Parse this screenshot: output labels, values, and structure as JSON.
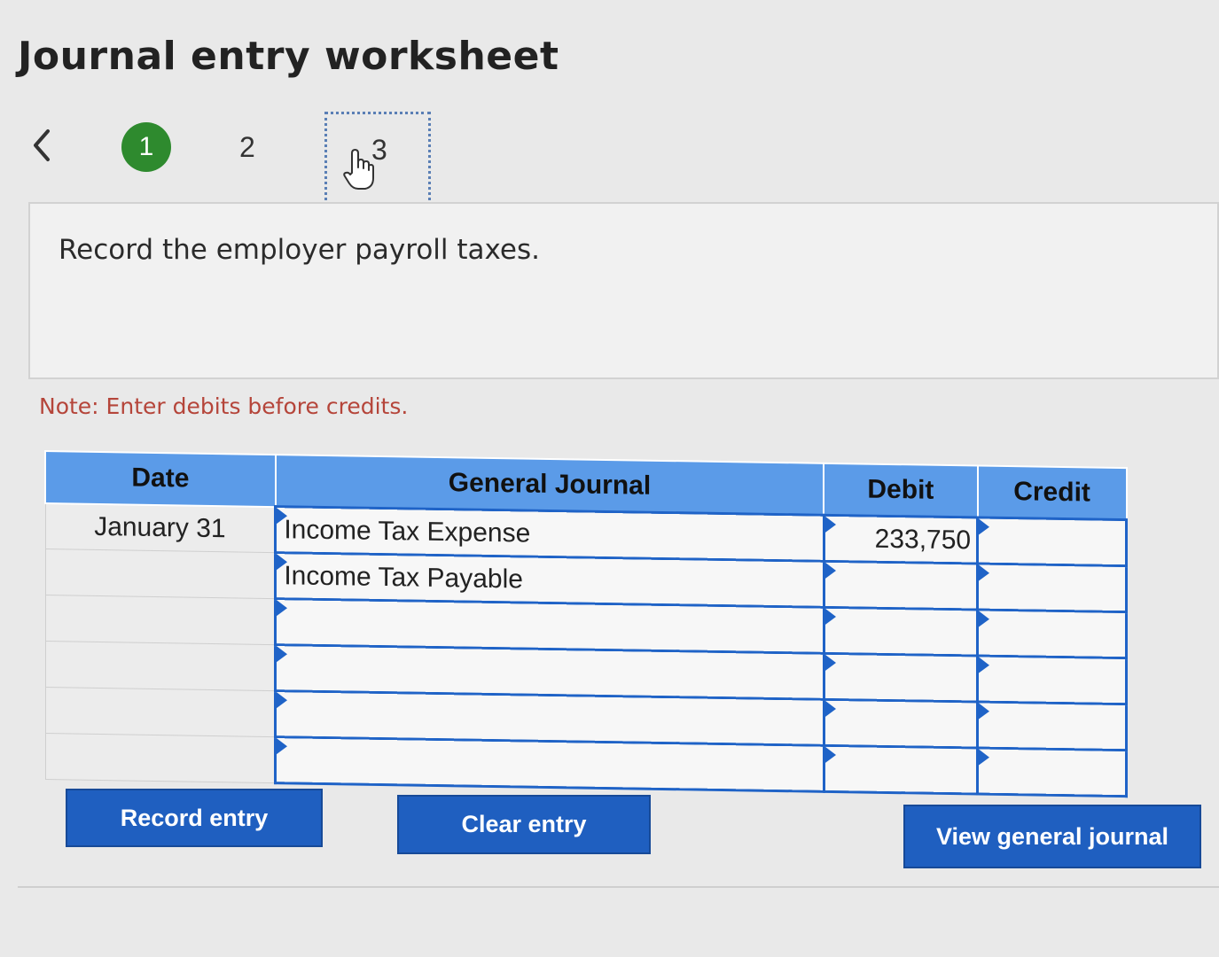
{
  "header": {
    "title": "Journal entry worksheet"
  },
  "stepper": {
    "steps": [
      {
        "label": "1",
        "state": "completed"
      },
      {
        "label": "2",
        "state": "default"
      },
      {
        "label": "3",
        "state": "hover"
      }
    ],
    "icons": {
      "back": "chevron-left-icon",
      "cursor": "hand-pointer-icon"
    }
  },
  "instruction": {
    "text": "Record the employer payroll taxes."
  },
  "note": {
    "text": "Note: Enter debits before credits."
  },
  "journal": {
    "headers": {
      "date": "Date",
      "account": "General Journal",
      "debit": "Debit",
      "credit": "Credit"
    },
    "rows": [
      {
        "date": "January 31",
        "account": "Income Tax Expense",
        "debit": "233,750",
        "credit": ""
      },
      {
        "date": "",
        "account": "Income Tax Payable",
        "debit": "",
        "credit": ""
      },
      {
        "date": "",
        "account": "",
        "debit": "",
        "credit": ""
      },
      {
        "date": "",
        "account": "",
        "debit": "",
        "credit": ""
      },
      {
        "date": "",
        "account": "",
        "debit": "",
        "credit": ""
      },
      {
        "date": "",
        "account": "",
        "debit": "",
        "credit": ""
      }
    ]
  },
  "buttons": {
    "record": "Record entry",
    "clear": "Clear entry",
    "view": "View general journal"
  },
  "colors": {
    "accent": "#1f5fc0",
    "header_blue": "#5b9be8",
    "step_active": "#2e8a2e",
    "note": "#b5453a"
  }
}
